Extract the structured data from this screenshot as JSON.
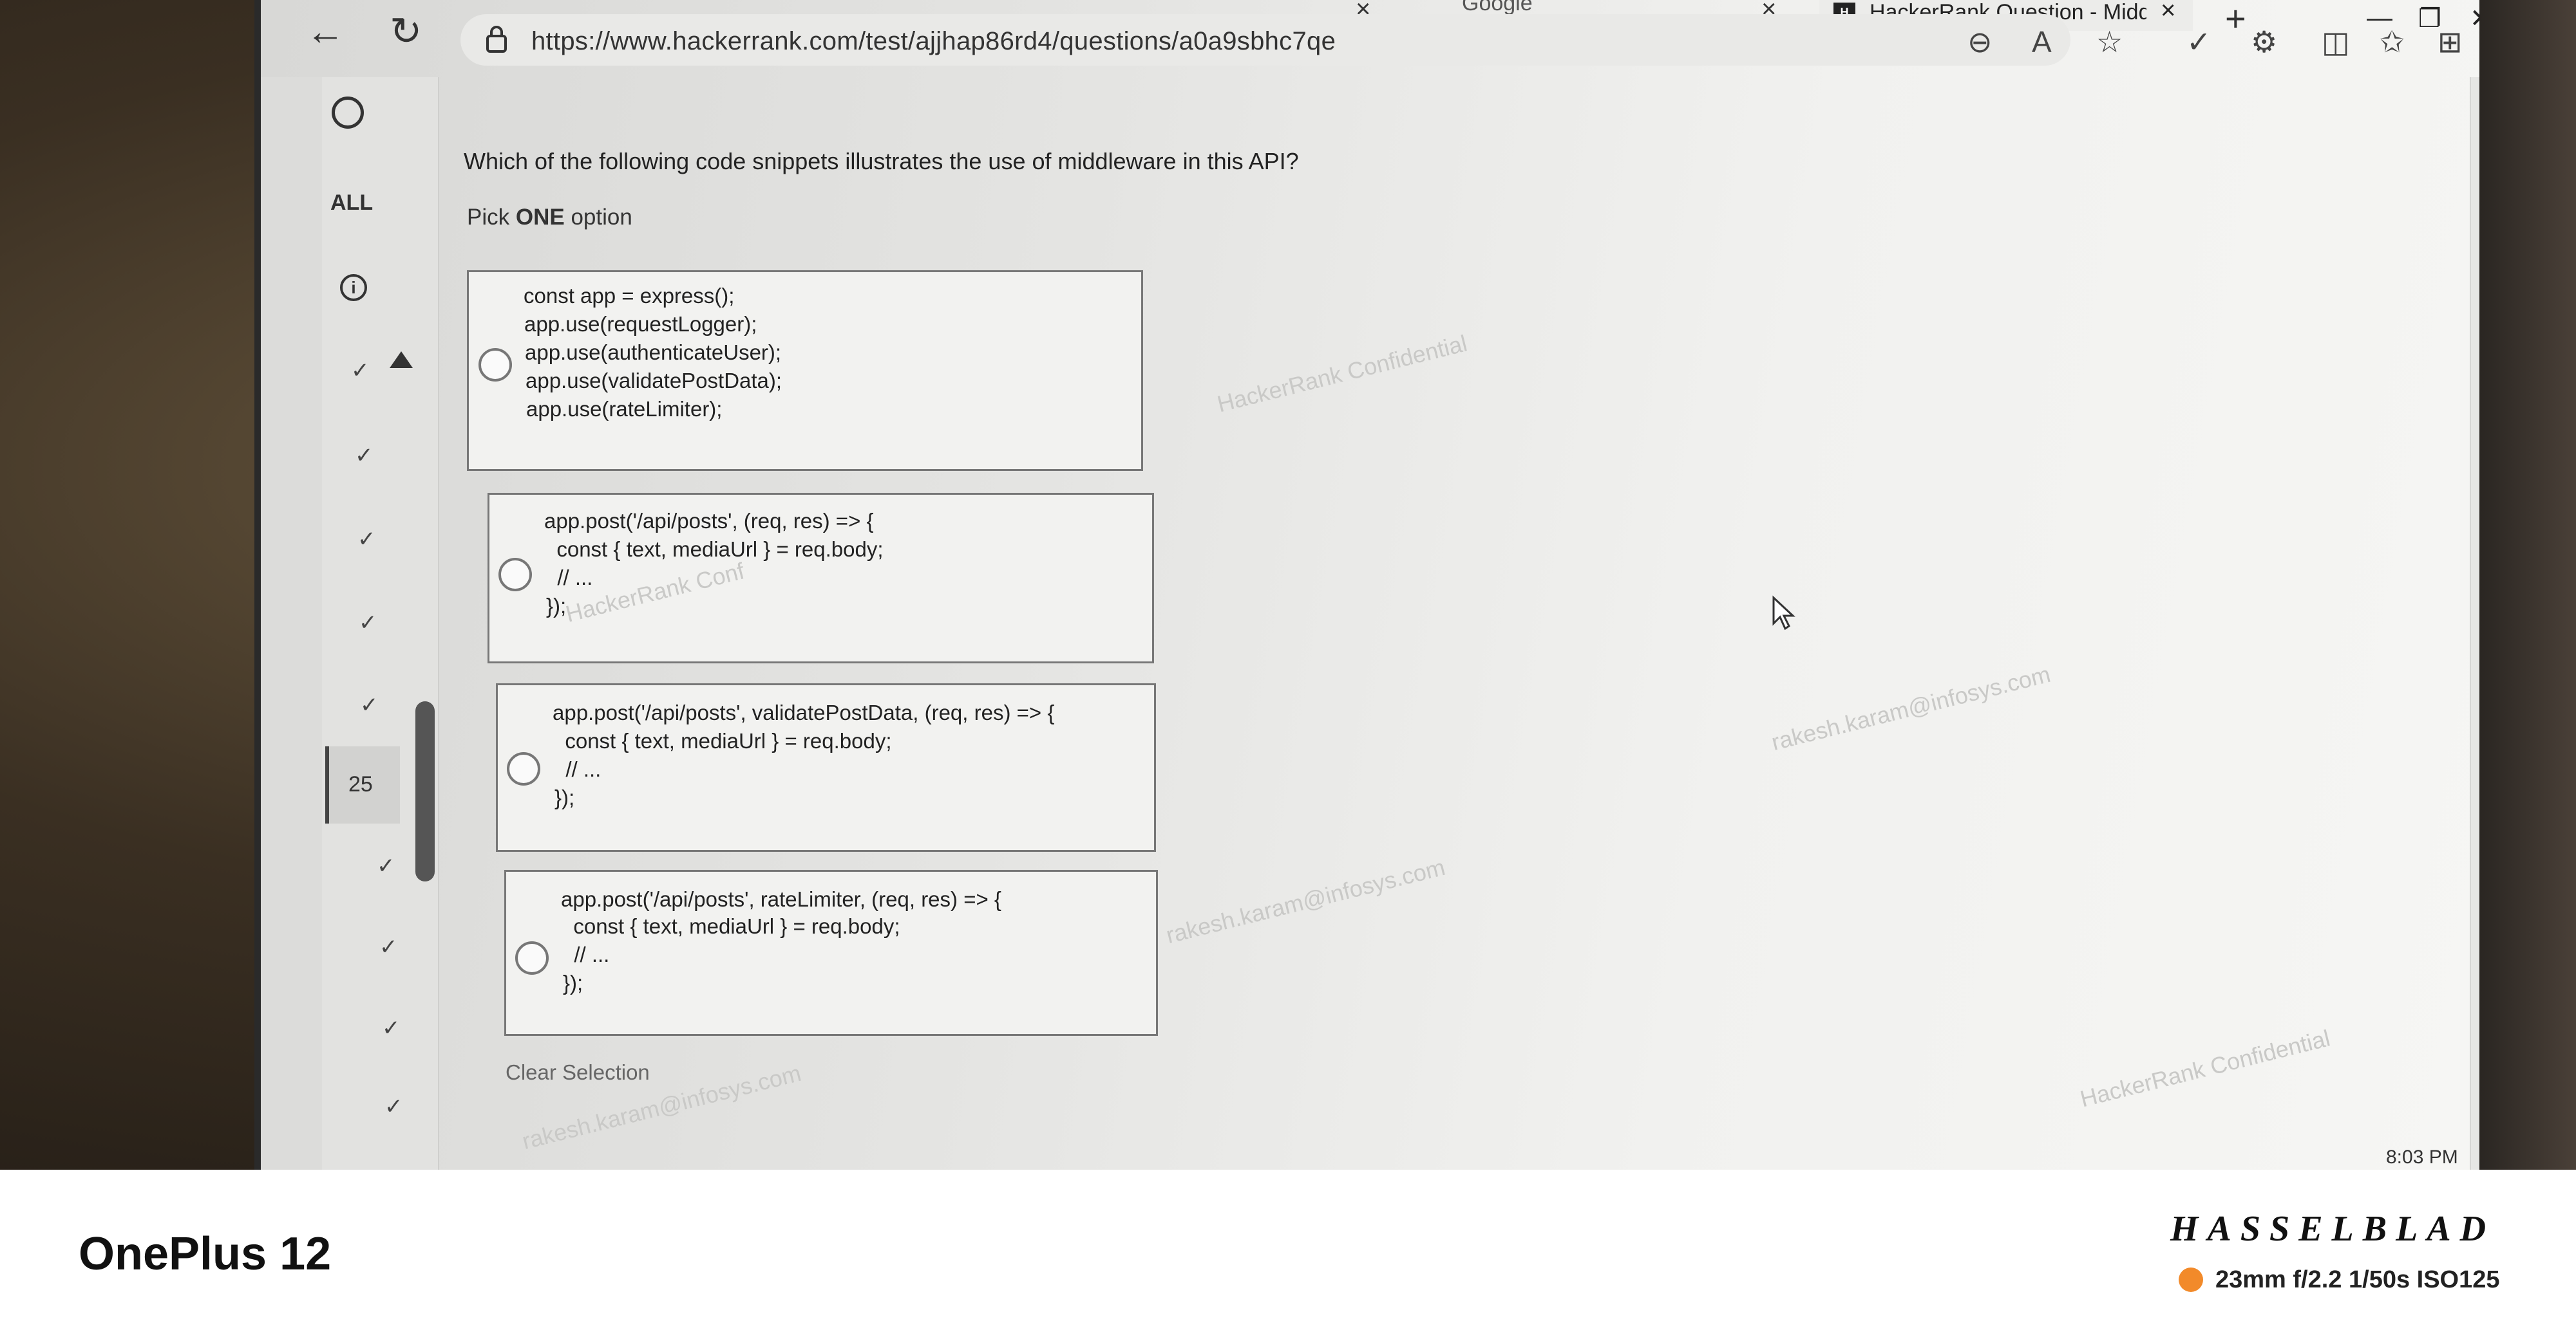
{
  "browser": {
    "tabs": [
      {
        "title": "Google"
      },
      {
        "title": "HackerRank Question - Middlew"
      }
    ],
    "url": "https://www.hackerrank.com/test/ajjhap86rd4/questions/a0a9sbhc7qe",
    "clock": "8:03 PM"
  },
  "sidebar": {
    "all_label": "ALL",
    "current_question": "25"
  },
  "question": {
    "text": "Which of the following code snippets illustrates the use of middleware in this API?",
    "pick_prefix": "Pick ",
    "pick_emphasis": "ONE",
    "pick_suffix": " option",
    "options": [
      {
        "lines": [
          "const app = express();",
          "app.use(requestLogger);",
          "app.use(authenticateUser);",
          "app.use(validatePostData);",
          "app.use(rateLimiter);"
        ]
      },
      {
        "lines": [
          "app.post('/api/posts', (req, res) => {",
          "  const { text, mediaUrl } = req.body;",
          "  // ...",
          "});"
        ]
      },
      {
        "lines": [
          "app.post('/api/posts', validatePostData, (req, res) => {",
          "  const { text, mediaUrl } = req.body;",
          "  // ...",
          "});"
        ]
      },
      {
        "lines": [
          "app.post('/api/posts', rateLimiter, (req, res) => {",
          "  const { text, mediaUrl } = req.body;",
          "  // ...",
          "});"
        ]
      }
    ],
    "clear_selection": "Clear Selection"
  },
  "watermarks": [
    "HackerRank Confidential",
    "HackerRank Conf",
    "rakesh.karam@infosys.com",
    "rakesh.karam@infosys.com",
    "rakesh.karam@infosys.com",
    "HackerRank Confidential"
  ],
  "camera": {
    "device": "OnePlus 12",
    "brand": "HASSELBLAD",
    "lens": "23mm  f/2.2  1/50s  ISO125",
    "accent_color": "#f28a2a"
  },
  "icons": [
    "back-icon",
    "refresh-icon",
    "lock-icon",
    "zoom-icon",
    "read-aloud-icon",
    "favorite-icon",
    "extensions-icon",
    "split-screen-icon",
    "favorites-icon",
    "collections-icon",
    "more-icon",
    "search-icon",
    "gear-icon",
    "plus-icon",
    "cursor-icon"
  ]
}
